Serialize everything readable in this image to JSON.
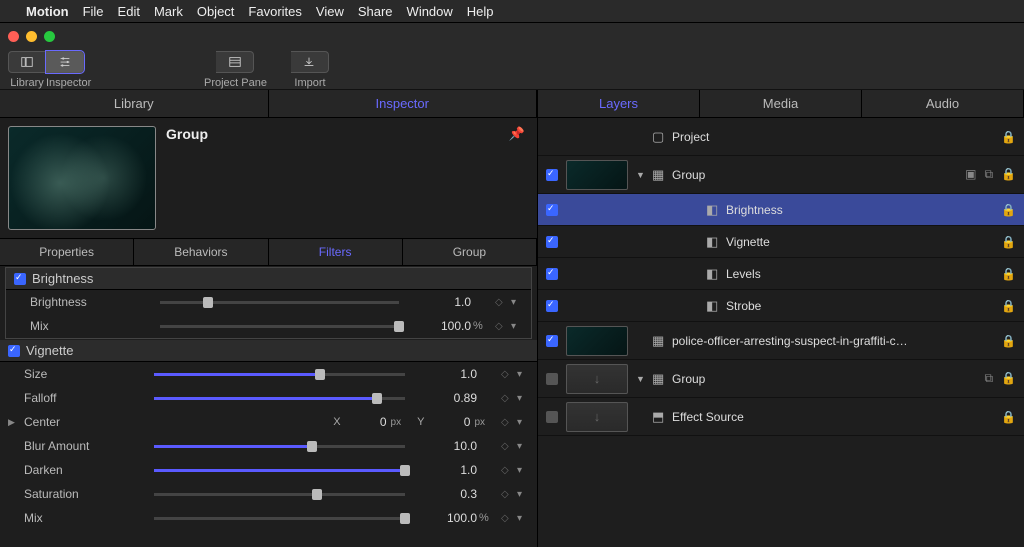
{
  "menubar": {
    "app": "Motion",
    "items": [
      "File",
      "Edit",
      "Mark",
      "Object",
      "Favorites",
      "View",
      "Share",
      "Window",
      "Help"
    ]
  },
  "toolbar": {
    "library_label": "Library",
    "inspector_label": "Inspector",
    "project_pane_label": "Project Pane",
    "import_label": "Import"
  },
  "left_tabs": {
    "library": "Library",
    "inspector": "Inspector"
  },
  "right_tabs": {
    "layers": "Layers",
    "media": "Media",
    "audio": "Audio"
  },
  "inspector": {
    "group_name": "Group",
    "subtabs": {
      "props": "Properties",
      "behaviors": "Behaviors",
      "filters": "Filters",
      "group": "Group"
    },
    "brightness": {
      "title": "Brightness",
      "params": {
        "brightness": {
          "label": "Brightness",
          "value": "1.0"
        },
        "mix": {
          "label": "Mix",
          "value": "100.0",
          "unit": "%"
        }
      }
    },
    "vignette": {
      "title": "Vignette",
      "params": {
        "size": {
          "label": "Size",
          "value": "1.0"
        },
        "falloff": {
          "label": "Falloff",
          "value": "0.89"
        },
        "center": {
          "label": "Center",
          "x_label": "X",
          "x_value": "0",
          "x_unit": "px",
          "y_label": "Y",
          "y_value": "0",
          "y_unit": "px"
        },
        "blur": {
          "label": "Blur Amount",
          "value": "10.0"
        },
        "darken": {
          "label": "Darken",
          "value": "1.0"
        },
        "saturation": {
          "label": "Saturation",
          "value": "0.3"
        },
        "mix": {
          "label": "Mix",
          "value": "100.0",
          "unit": "%"
        }
      }
    }
  },
  "layers": {
    "project": "Project",
    "rows": [
      {
        "name": "Group"
      },
      {
        "name": "Brightness"
      },
      {
        "name": "Vignette"
      },
      {
        "name": "Levels"
      },
      {
        "name": "Strobe"
      },
      {
        "name": "police-officer-arresting-suspect-in-graffiti-c…"
      },
      {
        "name": "Group"
      },
      {
        "name": "Effect Source"
      }
    ]
  }
}
